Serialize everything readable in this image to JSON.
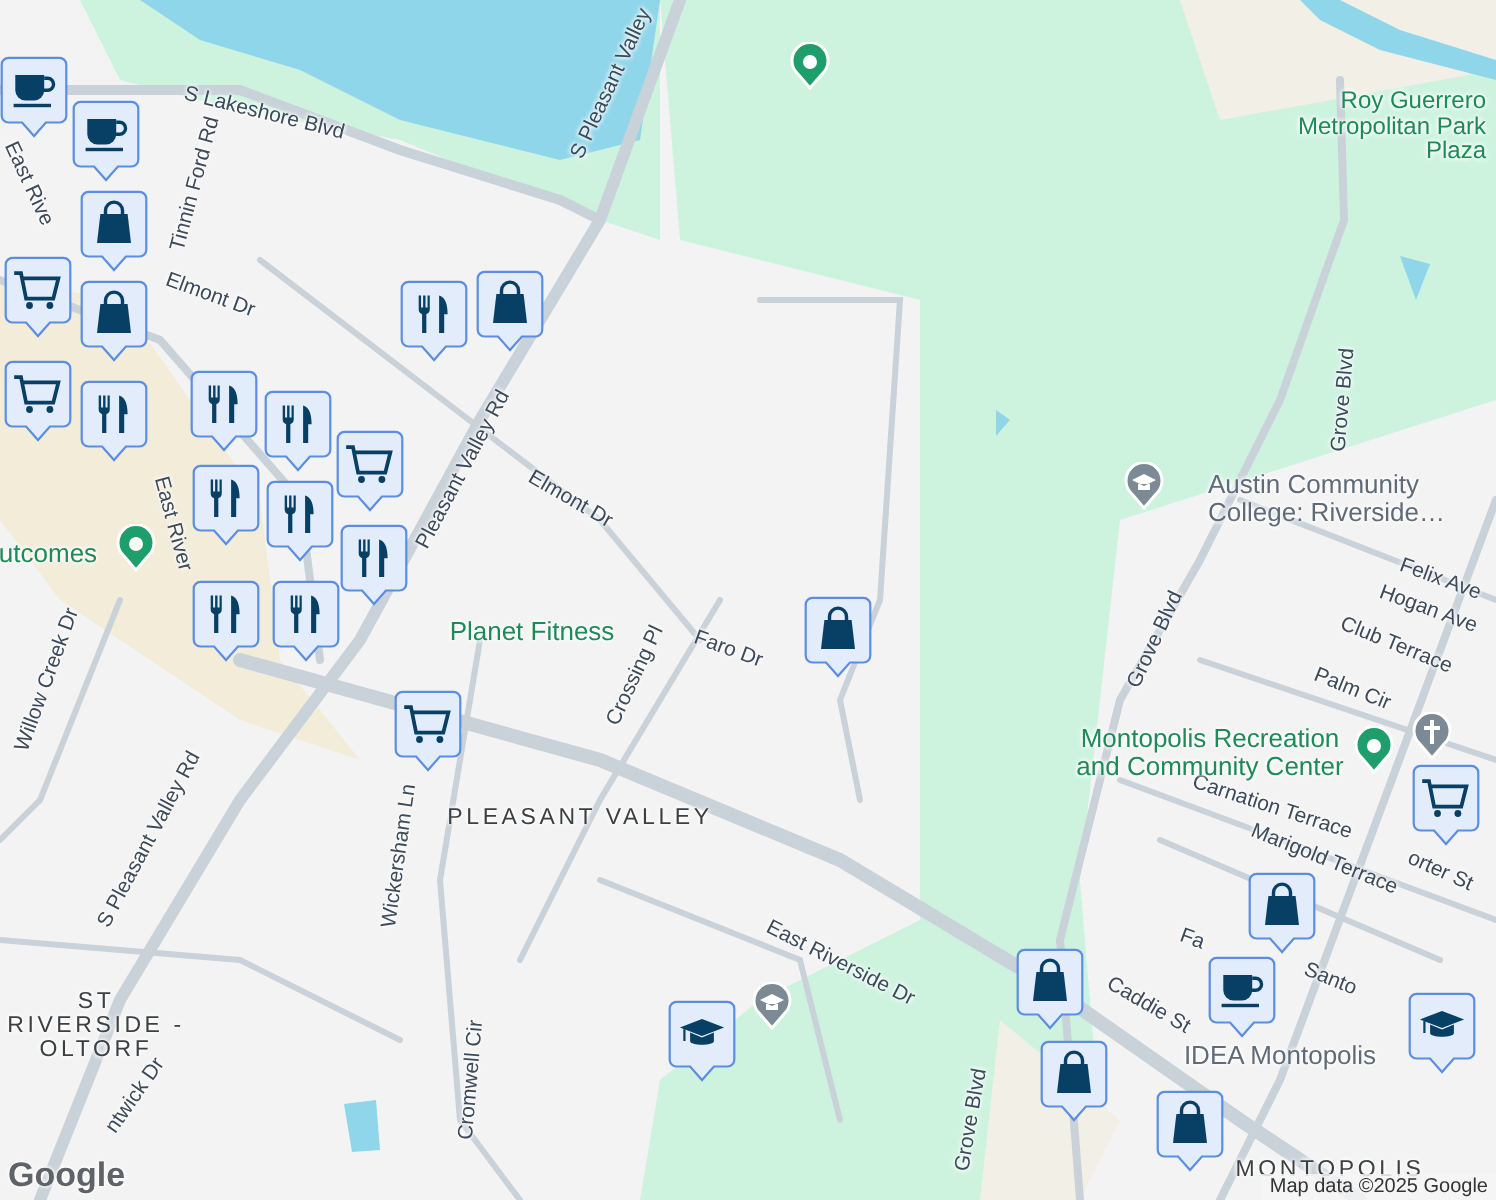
{
  "labels": [
    {
      "text": "S Lakeshore Blvd",
      "kind": "street"
    },
    {
      "text": "S Pleasant Valley",
      "kind": "street"
    },
    {
      "text": "Tinnin Ford Rd",
      "kind": "street"
    },
    {
      "text": "Elmont Dr",
      "kind": "street"
    },
    {
      "text": "Elmont Dr",
      "kind": "street"
    },
    {
      "text": "East Rive",
      "kind": "street"
    },
    {
      "text": "Pleasant Valley Rd",
      "kind": "street"
    },
    {
      "text": "East River",
      "kind": "street"
    },
    {
      "text": "Willow Creek Dr",
      "kind": "street"
    },
    {
      "text": "S Pleasant Valley Rd",
      "kind": "street"
    },
    {
      "text": "Wickersham Ln",
      "kind": "street"
    },
    {
      "text": "Crossing Pl",
      "kind": "street"
    },
    {
      "text": "Faro Dr",
      "kind": "street"
    },
    {
      "text": "Cromwell Cir",
      "kind": "street"
    },
    {
      "text": "East Riverside Dr",
      "kind": "street"
    },
    {
      "text": "Grove Blvd",
      "kind": "street"
    },
    {
      "text": "Grove Blvd",
      "kind": "street"
    },
    {
      "text": "Grove Blvd",
      "kind": "street"
    },
    {
      "text": "Felix Ave",
      "kind": "street"
    },
    {
      "text": "Hogan Ave",
      "kind": "street"
    },
    {
      "text": "Club Terrace",
      "kind": "street"
    },
    {
      "text": "Palm Cir",
      "kind": "street"
    },
    {
      "text": "Carnation Terrace",
      "kind": "street"
    },
    {
      "text": "orter St",
      "kind": "street"
    },
    {
      "text": "Marigold Terrace",
      "kind": "street"
    },
    {
      "text": "Fa",
      "kind": "street"
    },
    {
      "text": "Caddie St",
      "kind": "street"
    },
    {
      "text": "Santo",
      "kind": "street"
    },
    {
      "text": "ntwick Dr",
      "kind": "street"
    },
    {
      "text": "Roy Guerrero Metropolitan Park Plaza",
      "kind": "park"
    },
    {
      "text": "utcomes",
      "kind": "park"
    },
    {
      "text": "Planet Fitness",
      "kind": "park"
    },
    {
      "text": "Montopolis Recreation and Community Center",
      "kind": "park"
    },
    {
      "text": "Austin Community College: Riverside…",
      "kind": "poi"
    },
    {
      "text": "IDEA Montopolis",
      "kind": "poi"
    },
    {
      "text": "PLEASANT VALLEY",
      "kind": "area"
    },
    {
      "text": "ST RIVERSIDE - OLTORF",
      "kind": "area"
    },
    {
      "text": "MONTOPOLIS",
      "kind": "area"
    }
  ],
  "pins": [
    {
      "kind": "park"
    },
    {
      "kind": "park"
    },
    {
      "kind": "park"
    },
    {
      "kind": "school"
    },
    {
      "kind": "school"
    },
    {
      "kind": "church"
    }
  ],
  "markers": [
    {
      "kind": "cafe"
    },
    {
      "kind": "cafe"
    },
    {
      "kind": "shopping"
    },
    {
      "kind": "grocery"
    },
    {
      "kind": "shopping"
    },
    {
      "kind": "grocery"
    },
    {
      "kind": "restaurant"
    },
    {
      "kind": "restaurant"
    },
    {
      "kind": "restaurant"
    },
    {
      "kind": "grocery"
    },
    {
      "kind": "restaurant"
    },
    {
      "kind": "restaurant"
    },
    {
      "kind": "restaurant"
    },
    {
      "kind": "restaurant"
    },
    {
      "kind": "restaurant"
    },
    {
      "kind": "restaurant"
    },
    {
      "kind": "shopping"
    },
    {
      "kind": "grocery"
    },
    {
      "kind": "shopping"
    },
    {
      "kind": "school"
    },
    {
      "kind": "grocery"
    },
    {
      "kind": "shopping"
    },
    {
      "kind": "cafe"
    },
    {
      "kind": "shopping"
    },
    {
      "kind": "shopping"
    },
    {
      "kind": "school"
    },
    {
      "kind": "shopping"
    }
  ],
  "logo": "Google",
  "attribution": "Map data ©2025 Google"
}
